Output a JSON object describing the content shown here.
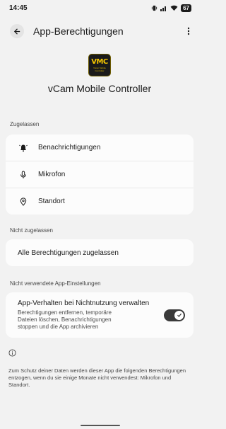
{
  "status_bar": {
    "time": "14:45",
    "battery": "67"
  },
  "app_bar": {
    "title": "App-Berechtigungen"
  },
  "app": {
    "logo_text": "VMC",
    "logo_subtext": "Vision Mobile Controller",
    "name": "vCam Mobile Controller"
  },
  "allowed": {
    "label": "Zugelassen",
    "items": [
      {
        "label": "Benachrichtigungen",
        "icon": "bell-icon"
      },
      {
        "label": "Mikrofon",
        "icon": "microphone-icon"
      },
      {
        "label": "Standort",
        "icon": "location-icon"
      }
    ]
  },
  "not_allowed": {
    "label": "Nicht zugelassen",
    "allow_all": "Alle Berechtigungen zugelassen"
  },
  "unused_settings": {
    "label": "Nicht verwendete App-Einstellungen",
    "title": "App-Verhalten bei Nichtnutzung verwalten",
    "description": "Berechtigungen entfernen, temporäre Dateien löschen, Benachrichtigungen stoppen und die App archivieren",
    "toggle_on": true
  },
  "footer": {
    "text": "Zum Schutz deiner Daten werden dieser App die folgenden Berechtigungen entzogen, wenn du sie einige Monate nicht verwendest: Mikrofon und Standort."
  },
  "colors": {
    "background": "#f2f2f2",
    "card": "#fcfcfc",
    "toggle": "#3a3a3a",
    "logo_accent": "#f6c700"
  }
}
